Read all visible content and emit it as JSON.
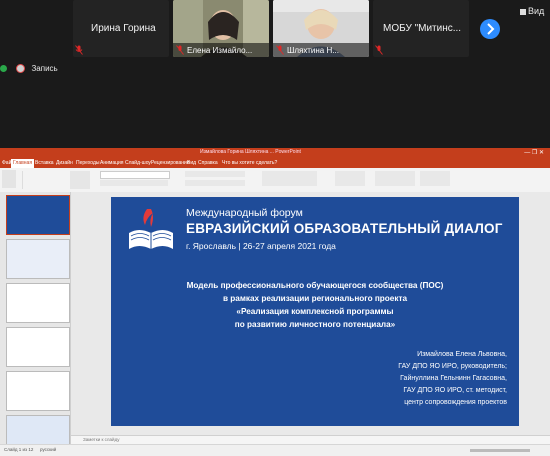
{
  "participants": [
    {
      "name": "Ирина Горина",
      "type": "name"
    },
    {
      "name": "Елена Измайло...",
      "type": "video"
    },
    {
      "name": "Шляхтина Н...",
      "type": "video"
    },
    {
      "name": "МОБУ \"Митинс...",
      "type": "name"
    }
  ],
  "toolbar": {
    "view_label": "Вид",
    "record_label": "Запись"
  },
  "ppt": {
    "window_title": "Измайлова Горина Шляхтина ... PowerPoint",
    "tabs": [
      "Файл",
      "Главная",
      "Вставка",
      "Дизайн",
      "Переходы",
      "Анимация",
      "Слайд-шоу",
      "Рецензирование",
      "Вид",
      "Справка",
      "Что вы хотите сделать?"
    ],
    "active_tab": "Главная",
    "notes_placeholder": "Заметки к слайду",
    "status_left": "Слайд 1 из 12",
    "status_right": "русский"
  },
  "slide": {
    "forum_line1": "Международный форум",
    "forum_line2": "ЕВРАЗИЙСКИЙ ОБРАЗОВАТЕЛЬНЫЙ ДИАЛОГ",
    "forum_line3": "г. Ярославль | 26-27 апреля 2021 года",
    "body": [
      "Модель профессионального обучающегося сообщества (ПОС)",
      "в рамках реализации регионального проекта",
      "«Реализация комплексной программы",
      "по развитию личностного потенциала»"
    ],
    "authors": [
      "Измайлова Елена Львовна,",
      "ГАУ ДПО ЯО ИРО, руководитель;",
      "Гайнуллина Гельнинн Гагасовна,",
      "ГАУ ДПО ЯО ИРО, ст. методист,",
      "центр сопровождения проектов"
    ]
  },
  "colors": {
    "ppt_accent": "#c43e1c",
    "slide_bg": "#1f4c99",
    "zoom_blue": "#2d8cff",
    "mic_muted": "#e02828"
  }
}
